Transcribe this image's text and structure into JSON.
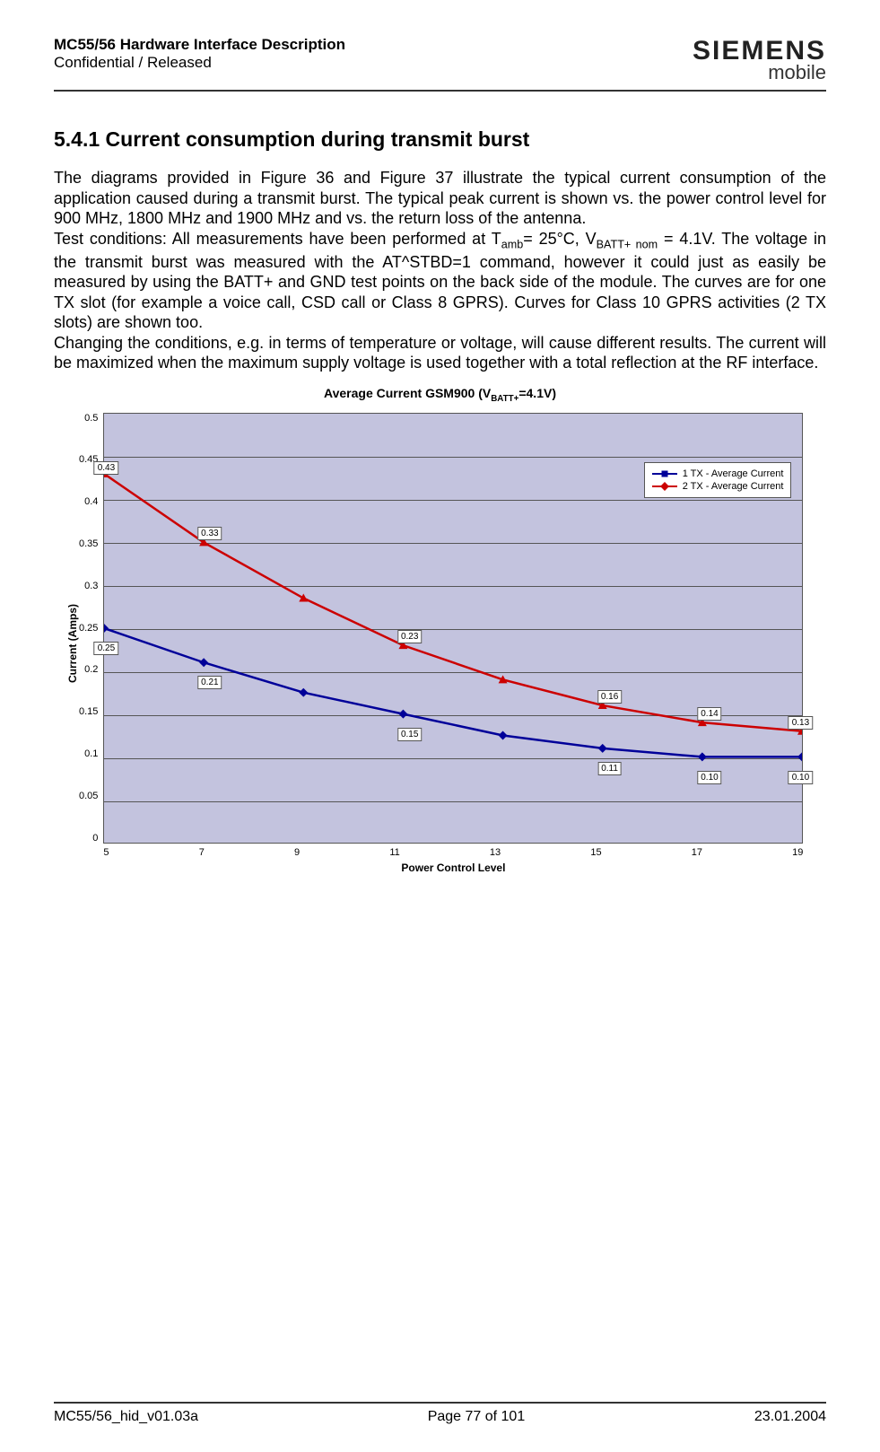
{
  "header": {
    "title": "MC55/56 Hardware Interface Description",
    "confidential": "Confidential / Released",
    "logo_top": "SIEMENS",
    "logo_bottom": "mobile"
  },
  "section": {
    "number": "5.4.1",
    "heading": "Current consumption during transmit burst"
  },
  "paragraphs": {
    "p1": "The diagrams provided in Figure 36 and Figure 37 illustrate the typical current consumption of the application caused during a transmit burst. The typical peak current is shown vs. the power control level for 900 MHz, 1800 MHz and 1900 MHz and vs. the return loss of the antenna.",
    "p2a": "Test conditions: All measurements have been performed at T",
    "p2_sub1": "amb",
    "p2b": "= 25°C, V",
    "p2_sub2": "BATT+ nom",
    "p2c": " = 4.1V. The voltage in the transmit burst was measured with the AT^STBD=1 command, however it could just as easily be measured by using the BATT+ and GND test points on the back side of the module. The curves are for one TX slot (for example a voice call, CSD call or Class 8 GPRS). Curves for Class 10 GPRS activities (2 TX slots) are shown too.",
    "p3": "Changing the conditions, e.g. in terms of temperature or voltage, will cause different results. The current will be maximized when the maximum supply voltage is used together with a total reflection at the RF interface."
  },
  "chart_data": {
    "type": "line",
    "title_prefix": "Average Current GSM900 (V",
    "title_sub": "BATT+",
    "title_suffix": "=4.1V)",
    "xlabel": "Power Control Level",
    "ylabel": "Current (Amps)",
    "x": [
      5,
      7,
      9,
      11,
      13,
      15,
      17,
      19
    ],
    "ylim": [
      0,
      0.5
    ],
    "xlim": [
      5,
      19
    ],
    "yticks": [
      "0.5",
      "0.45",
      "0.4",
      "0.35",
      "0.3",
      "0.25",
      "0.2",
      "0.15",
      "0.1",
      "0.05",
      "0"
    ],
    "xticks": [
      "5",
      "7",
      "9",
      "11",
      "13",
      "15",
      "17",
      "19"
    ],
    "series": [
      {
        "name": "1 TX - Average Current",
        "color": "#000099",
        "marker": "diamond",
        "values": [
          0.25,
          0.21,
          0.175,
          0.15,
          0.125,
          0.11,
          0.1,
          0.1
        ],
        "labels": [
          "0.25",
          "0.21",
          "",
          "0.15",
          "",
          "0.11",
          "0.10",
          "0.10"
        ]
      },
      {
        "name": "2 TX - Average Current",
        "color": "#cc0000",
        "marker": "triangle",
        "values": [
          0.43,
          0.35,
          0.285,
          0.23,
          0.19,
          0.16,
          0.14,
          0.13
        ],
        "labels": [
          "0.43",
          "0.33",
          "",
          "0.23",
          "",
          "0.16",
          "0.14",
          "0.13"
        ]
      }
    ],
    "legend": [
      "1 TX - Average Current",
      "2 TX - Average Current"
    ]
  },
  "footer": {
    "left": "MC55/56_hid_v01.03a",
    "center": "Page 77 of 101",
    "right": "23.01.2004"
  }
}
